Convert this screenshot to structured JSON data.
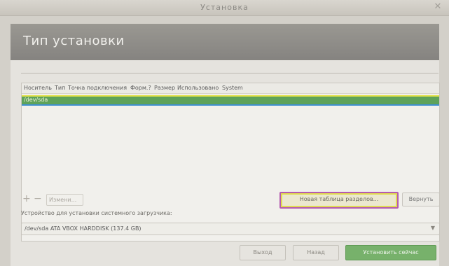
{
  "window": {
    "title": "Установка"
  },
  "header": {
    "title": "Тип установки"
  },
  "table": {
    "columns": [
      "Носитель",
      "Тип",
      "Точка подключения",
      "Форм.?",
      "Размер",
      "Использовано",
      "System"
    ],
    "rows": [
      {
        "device": "/dev/sda"
      }
    ]
  },
  "controls": {
    "add_label": "+",
    "remove_label": "−",
    "change_label": "Измени...",
    "new_table_label": "Новая таблица разделов...",
    "revert_label": "Вернуть"
  },
  "bootloader": {
    "label": "Устройство для установки системного загрузчика:",
    "value": "/dev/sda ATA VBOX HARDDISK (137.4 GB)"
  },
  "footer": {
    "quit_label": "Выход",
    "back_label": "Назад",
    "install_label": "Установить сейчас"
  },
  "colors": {
    "selected_row": "#5ea25a",
    "install_button": "#77b16b",
    "header_bg": "#8f8d88"
  },
  "icons": {
    "close": "close-icon",
    "add": "plus-icon",
    "remove": "minus-icon",
    "dropdown": "chevron-down-icon"
  }
}
